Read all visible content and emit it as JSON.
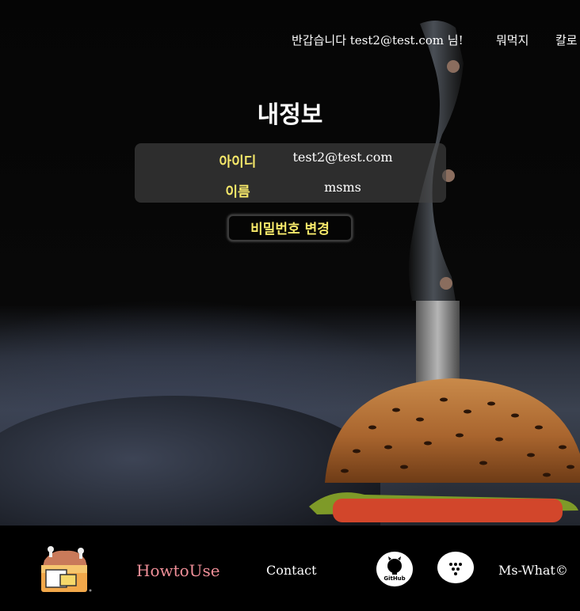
{
  "header": {
    "greeting": "반갑습니다 test2@test.com 님!",
    "menu": [
      "뭐먹지",
      "칼로"
    ]
  },
  "page": {
    "title": "내정보"
  },
  "info": {
    "rows": [
      {
        "label": "아이디",
        "value": "test2@test.com"
      },
      {
        "label": "이름",
        "value": "msms"
      }
    ]
  },
  "actions": {
    "change_password_label": "비밀번호 변경"
  },
  "footer": {
    "howto_label": "HowtoUse",
    "contact_label": "Contact",
    "github_label": "GitHub",
    "copyright": "Ms-What©"
  },
  "colors": {
    "accent_yellow": "#f7e96a",
    "link_pink": "#f08f98",
    "background": "#000000"
  },
  "icons": [
    "logo-icon",
    "github-icon",
    "dots-icon"
  ]
}
